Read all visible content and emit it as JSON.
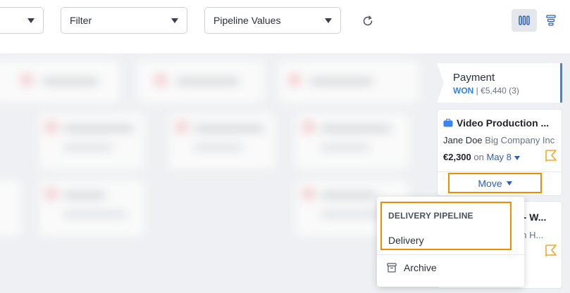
{
  "toolbar": {
    "first_select_value": "",
    "filter_label": "Filter",
    "pipeline_values_label": "Pipeline Values"
  },
  "column": {
    "title": "Payment",
    "status": "WON",
    "separator": "|",
    "summary": "€5,440 (3)"
  },
  "deal": {
    "title": "Video Production ...",
    "person": "Jane Doe",
    "organization": "Big Company Inc",
    "amount": "€2,300",
    "on_text": "on",
    "date": "May 8",
    "move_label": "Move"
  },
  "deal2": {
    "title_fragment": "s - W...",
    "person_fragment": "on H..."
  },
  "dropdown": {
    "group_heading": "DELIVERY PIPELINE",
    "stage": "Delivery",
    "archive_label": "Archive"
  },
  "colors": {
    "accent": "#2f80ed",
    "highlight": "#f08c00",
    "flag": "#f5a623"
  }
}
